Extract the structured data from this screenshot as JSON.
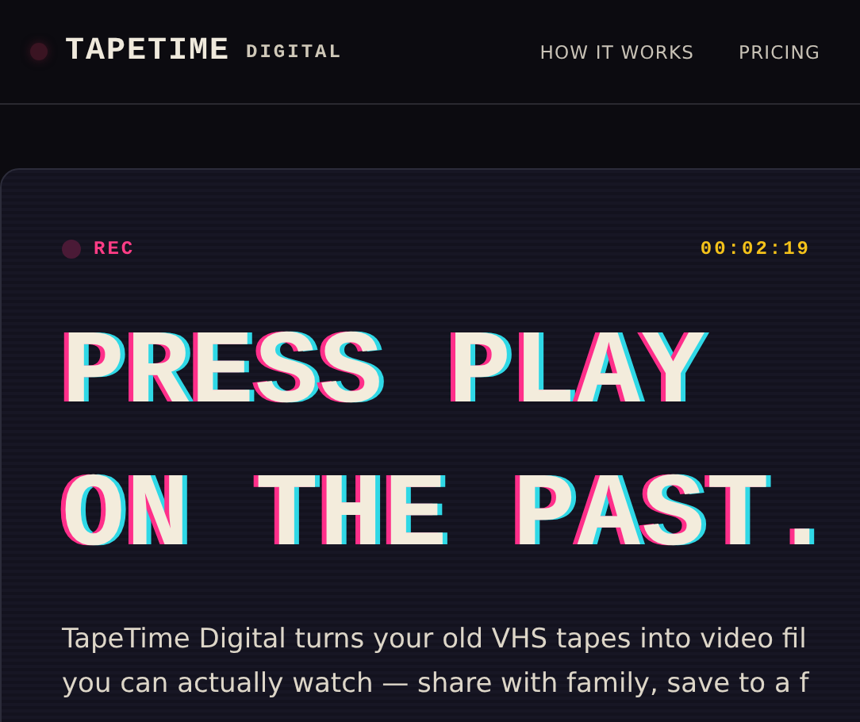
{
  "header": {
    "logo": "TAPETIME",
    "logo_suffix": "DIGITAL",
    "nav": [
      {
        "label": "HOW IT WORKS"
      },
      {
        "label": "PRICING"
      }
    ]
  },
  "hero": {
    "rec_label": "REC",
    "recording": true,
    "timecode": "00:02:19",
    "headline": [
      "PRESS PLAY",
      "ON THE PAST."
    ],
    "intro_lines": [
      "TapeTime Digital turns your old VHS tapes into video fil",
      "you can actually watch — share with family, save to a f"
    ]
  }
}
